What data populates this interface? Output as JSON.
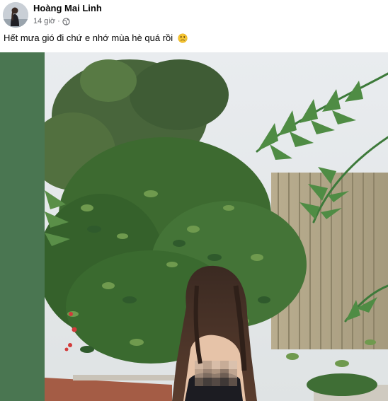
{
  "post": {
    "author": "Hoàng Mai Linh",
    "time": "14 giờ",
    "separator": "·",
    "audience_icon": "globe-icon",
    "text": "Hết mưa gió đi chứ e nhớ mùa hè quá rồi",
    "emoji_icon": "sad-face-emoji-icon"
  },
  "colors": {
    "name_text": "#050505",
    "meta_text": "#65676b",
    "side_panel": "#4a7651",
    "foliage_dark": "#2f5a2c",
    "foliage_light": "#6f9a4e"
  }
}
